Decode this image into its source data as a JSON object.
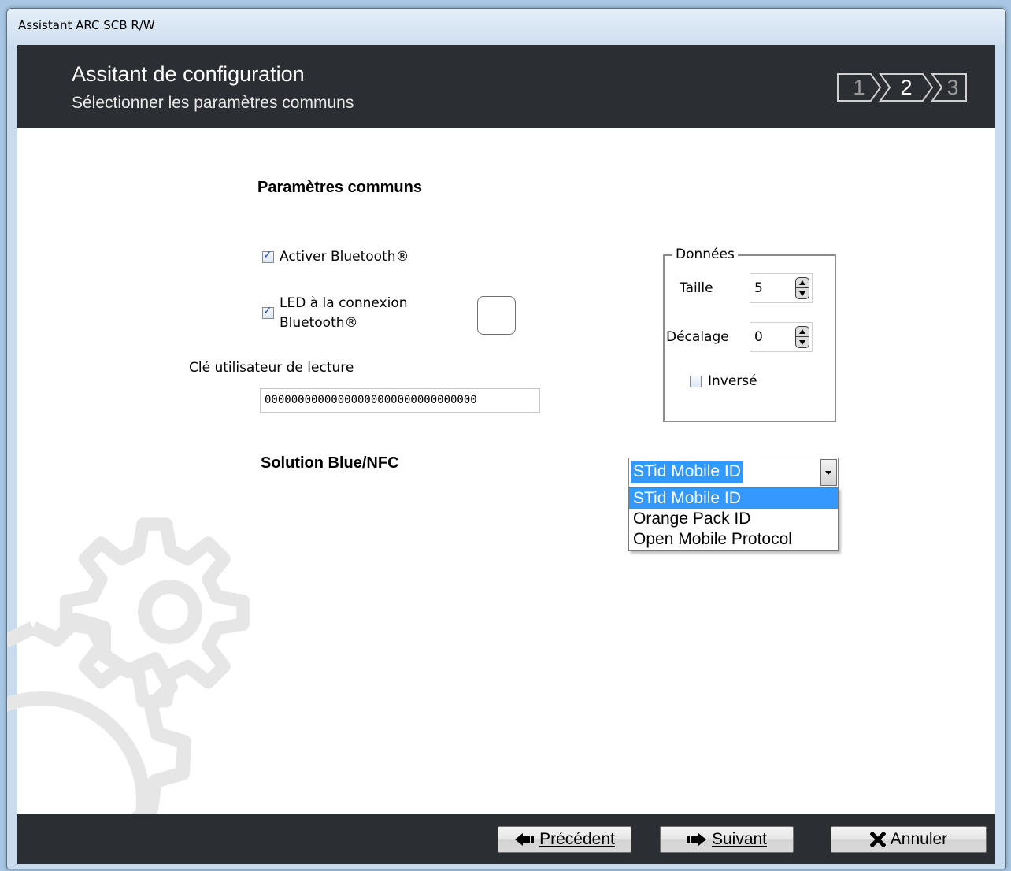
{
  "window": {
    "title": "Assistant ARC SCB R/W"
  },
  "header": {
    "title": "Assitant de configuration",
    "subtitle": "Sélectionner les paramètres communs",
    "steps": [
      "1",
      "2",
      "3"
    ],
    "current_step": "2"
  },
  "common_params": {
    "title": "Paramètres communs",
    "bluetooth": {
      "label": "Activer Bluetooth®",
      "checked": true
    },
    "led": {
      "label_line1": "LED à la connexion",
      "label_line2": "Bluetooth®",
      "checked": true
    },
    "read_key": {
      "label": "Clé utilisateur de lecture",
      "value": "00000000000000000000000000000000"
    }
  },
  "data_group": {
    "legend": "Données",
    "size": {
      "label": "Taille",
      "value": "5"
    },
    "offset": {
      "label": "Décalage",
      "value": "0"
    },
    "reverse": {
      "label": "Inversé",
      "checked": false
    }
  },
  "solution": {
    "title": "Solution Blue/NFC",
    "selected": "STid Mobile ID",
    "options": [
      "STid Mobile ID",
      "Orange Pack ID",
      "Open Mobile Protocol"
    ]
  },
  "footer": {
    "previous": "Précédent",
    "next": "Suivant",
    "cancel": "Annuler"
  },
  "colors": {
    "header_bg": "#2b2f33",
    "selection": "#3399ff",
    "gear": "#e6e6e6"
  }
}
